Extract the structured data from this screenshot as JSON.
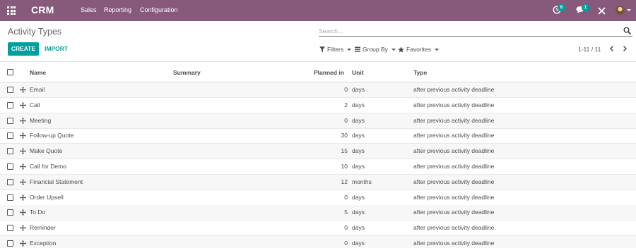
{
  "navbar": {
    "brand": "CRM",
    "menu": [
      "Sales",
      "Reporting",
      "Configuration"
    ],
    "activity_count": "6",
    "message_count": "1",
    "color": "#875a7b"
  },
  "control_panel": {
    "title": "Activity Types",
    "search_placeholder": "Search...",
    "create_label": "CREATE",
    "import_label": "IMPORT",
    "filters_label": "Filters",
    "group_by_label": "Group By",
    "favorites_label": "Favorites",
    "pager": "1-11 / 11",
    "accent": "#00a09d"
  },
  "table": {
    "columns": {
      "name": "Name",
      "summary": "Summary",
      "planned_in": "Planned in",
      "unit": "Unit",
      "type": "Type"
    },
    "rows": [
      {
        "name": "Email",
        "summary": "",
        "planned": "0",
        "unit": "days",
        "type": "after previous activity deadline"
      },
      {
        "name": "Call",
        "summary": "",
        "planned": "2",
        "unit": "days",
        "type": "after previous activity deadline"
      },
      {
        "name": "Meeting",
        "summary": "",
        "planned": "0",
        "unit": "days",
        "type": "after previous activity deadline"
      },
      {
        "name": "Follow-up Quote",
        "summary": "",
        "planned": "30",
        "unit": "days",
        "type": "after previous activity deadline"
      },
      {
        "name": "Make Quote",
        "summary": "",
        "planned": "15",
        "unit": "days",
        "type": "after previous activity deadline"
      },
      {
        "name": "Call for Demo",
        "summary": "",
        "planned": "10",
        "unit": "days",
        "type": "after previous activity deadline"
      },
      {
        "name": "Financial Statement",
        "summary": "",
        "planned": "12",
        "unit": "months",
        "type": "after previous activity deadline"
      },
      {
        "name": "Order Upsell",
        "summary": "",
        "planned": "0",
        "unit": "days",
        "type": "after previous activity deadline"
      },
      {
        "name": "To Do",
        "summary": "",
        "planned": "5",
        "unit": "days",
        "type": "after previous activity deadline"
      },
      {
        "name": "Reminder",
        "summary": "",
        "planned": "0",
        "unit": "days",
        "type": "after previous activity deadline"
      },
      {
        "name": "Exception",
        "summary": "",
        "planned": "0",
        "unit": "days",
        "type": "after previous activity deadline"
      }
    ]
  }
}
